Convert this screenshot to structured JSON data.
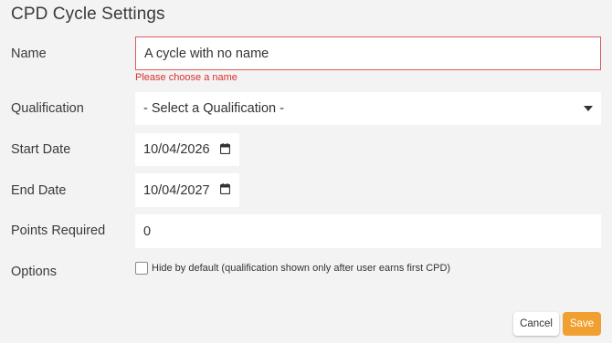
{
  "page": {
    "title": "CPD Cycle Settings"
  },
  "form": {
    "name": {
      "label": "Name",
      "value": "A cycle with no name",
      "error": "Please choose a name"
    },
    "qualification": {
      "label": "Qualification",
      "value": "- Select a Qualification -"
    },
    "start_date": {
      "label": "Start Date",
      "value": "10/04/2026"
    },
    "end_date": {
      "label": "End Date",
      "value": "10/04/2027"
    },
    "points_required": {
      "label": "Points Required",
      "value": "0"
    },
    "options": {
      "label": "Options",
      "hide_by_default_label": "Hide by default (qualification shown only after user earns first CPD)",
      "hide_by_default_checked": false
    }
  },
  "actions": {
    "cancel_label": "Cancel",
    "save_label": "Save"
  },
  "colors": {
    "error": "#e05a5a",
    "save_button": "#f0a030"
  },
  "icons": {
    "date_picker": "calendar-icon",
    "dropdown": "caret-down-icon"
  }
}
